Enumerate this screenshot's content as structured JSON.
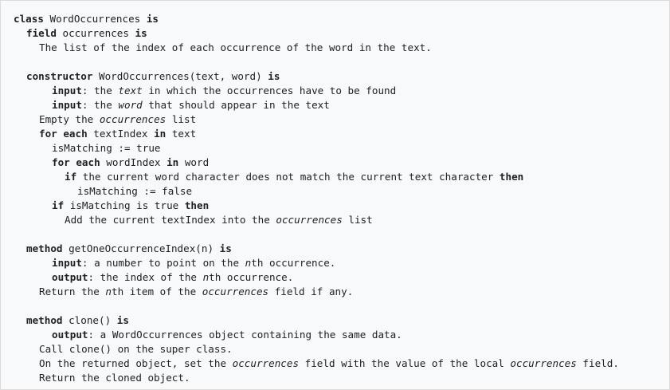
{
  "code": {
    "l1": [
      "class",
      " WordOccurrences ",
      "is"
    ],
    "l2": [
      "field",
      " occurrences ",
      "is"
    ],
    "l3": [
      "The list of the index of each occurrence of the word in the text."
    ],
    "l5": [
      "constructor",
      " WordOccurrences(text, word) ",
      "is"
    ],
    "l6": [
      "input",
      ": the ",
      "text",
      " in which the occurrences have to be found"
    ],
    "l7": [
      "input",
      ": the ",
      "word",
      " that should appear in the text"
    ],
    "l8": [
      "Empty the ",
      "occurrences",
      " list"
    ],
    "l9": [
      "for each",
      " textIndex ",
      "in",
      " text"
    ],
    "l10": [
      "isMatching := true"
    ],
    "l11": [
      "for each",
      " wordIndex ",
      "in",
      " word"
    ],
    "l12": [
      "if",
      " the current word character does not match the current text character ",
      "then"
    ],
    "l13": [
      "isMatching := false"
    ],
    "l14": [
      "if",
      " isMatching is true ",
      "then"
    ],
    "l15": [
      "Add the current textIndex into the ",
      "occurrences",
      " list"
    ],
    "l17": [
      "method",
      " getOneOccurrenceIndex(n) ",
      "is"
    ],
    "l18": [
      "input",
      ": a number to point on the ",
      "n",
      "th occurrence."
    ],
    "l19": [
      "output",
      ": the index of the ",
      "n",
      "th occurrence."
    ],
    "l20": [
      "Return the ",
      "n",
      "th item of the ",
      "occurrences",
      " field if any."
    ],
    "l22": [
      "method",
      " clone() ",
      "is"
    ],
    "l23": [
      "output",
      ": a WordOccurrences object containing the same data."
    ],
    "l24": [
      "Call clone() on the super class."
    ],
    "l25": [
      "On the returned object, set the ",
      "occurrences",
      " field with the value of the local ",
      "occurrences",
      " field."
    ],
    "l26": [
      "Return the cloned object."
    ]
  }
}
